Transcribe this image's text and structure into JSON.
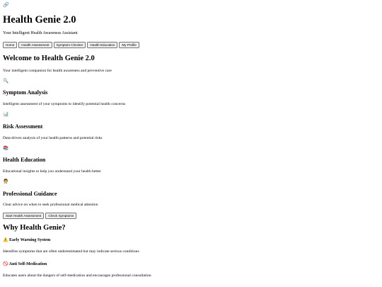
{
  "header": {
    "logo_icon": "🔗",
    "title": "Health Genie 2.0",
    "tagline": "Your Intelligent Health Awareness Assistant"
  },
  "nav": [
    "Home",
    "Health Assessment",
    "Symptom Checker",
    "Health Education",
    "My Profile"
  ],
  "hero": {
    "title": "Welcome to Health Genie 2.0",
    "subtitle": "Your intelligent companion for health awareness and preventive care"
  },
  "features": [
    {
      "icon": "🔍",
      "icon_name": "magnifier-icon",
      "title": "Symptom Analysis",
      "desc": "Intelligent assessment of your symptoms to identify potential health concerns"
    },
    {
      "icon": "📊",
      "icon_name": "bar-chart-icon",
      "title": "Risk Assessment",
      "desc": "Data-driven analysis of your health patterns and potential risks"
    },
    {
      "icon": "📚",
      "icon_name": "books-icon",
      "title": "Health Education",
      "desc": "Educational insights to help you understand your health better"
    },
    {
      "icon": "🧑‍⚕️",
      "icon_name": "health-worker-icon",
      "title": "Professional Guidance",
      "desc": "Clear advice on when to seek professional medical attention"
    }
  ],
  "cta": [
    "Start Health Assessment",
    "Check Symptoms"
  ],
  "why": {
    "title": "Why Health Genie?",
    "items": [
      {
        "icon": "⚠️",
        "icon_name": "warning-icon",
        "title": "Early Warning System",
        "desc": "Identifies symptoms that are often underestimated but may indicate serious conditions"
      },
      {
        "icon": "🚫",
        "icon_name": "prohibited-icon",
        "title": "Anti Self-Medication",
        "desc": "Educates users about the dangers of self-medication and encourages professional consultation"
      }
    ]
  },
  "colors": {
    "button_bg": "#efefef",
    "button_border": "#767676",
    "page_bg": "#ffffff"
  }
}
